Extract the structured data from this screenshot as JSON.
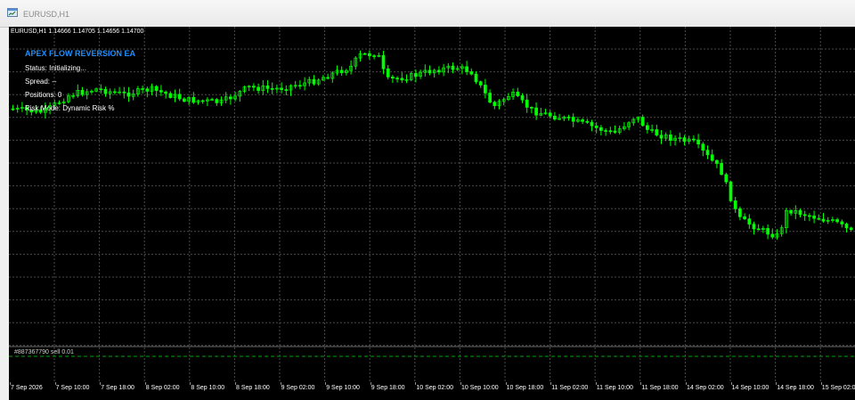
{
  "window": {
    "title": "EURUSD,H1"
  },
  "chart": {
    "symbol_info": "EURUSD,H1  1.14666 1.14705 1.14656 1.14700",
    "background": "#000000",
    "bull_color": "#00ff00",
    "bear_color": "#00ff00",
    "grid_color": "#4a4a4a"
  },
  "ea_panel": {
    "title": "APEX FLOW REVERSION EA",
    "title_color": "#1e90ff",
    "lines": [
      "Status: Initializing...",
      "Spread: --",
      "Positions: 0",
      "Risk Mode: Dynamic Risk %"
    ]
  },
  "order_line": {
    "label": "#887367790 sell 0.01",
    "color": "#00aa00"
  },
  "time_axis": {
    "labels": [
      "7 Sep 2026",
      "7 Sep 10:00",
      "7 Sep 18:00",
      "8 Sep 02:00",
      "8 Sep 10:00",
      "8 Sep 18:00",
      "9 Sep 02:00",
      "9 Sep 10:00",
      "9 Sep 18:00",
      "10 Sep 02:00",
      "10 Sep 10:00",
      "10 Sep 18:00",
      "11 Sep 02:00",
      "11 Sep 10:00",
      "11 Sep 18:00",
      "14 Sep 02:00",
      "14 Sep 10:00",
      "14 Sep 18:00",
      "15 Sep 02:00"
    ]
  }
}
